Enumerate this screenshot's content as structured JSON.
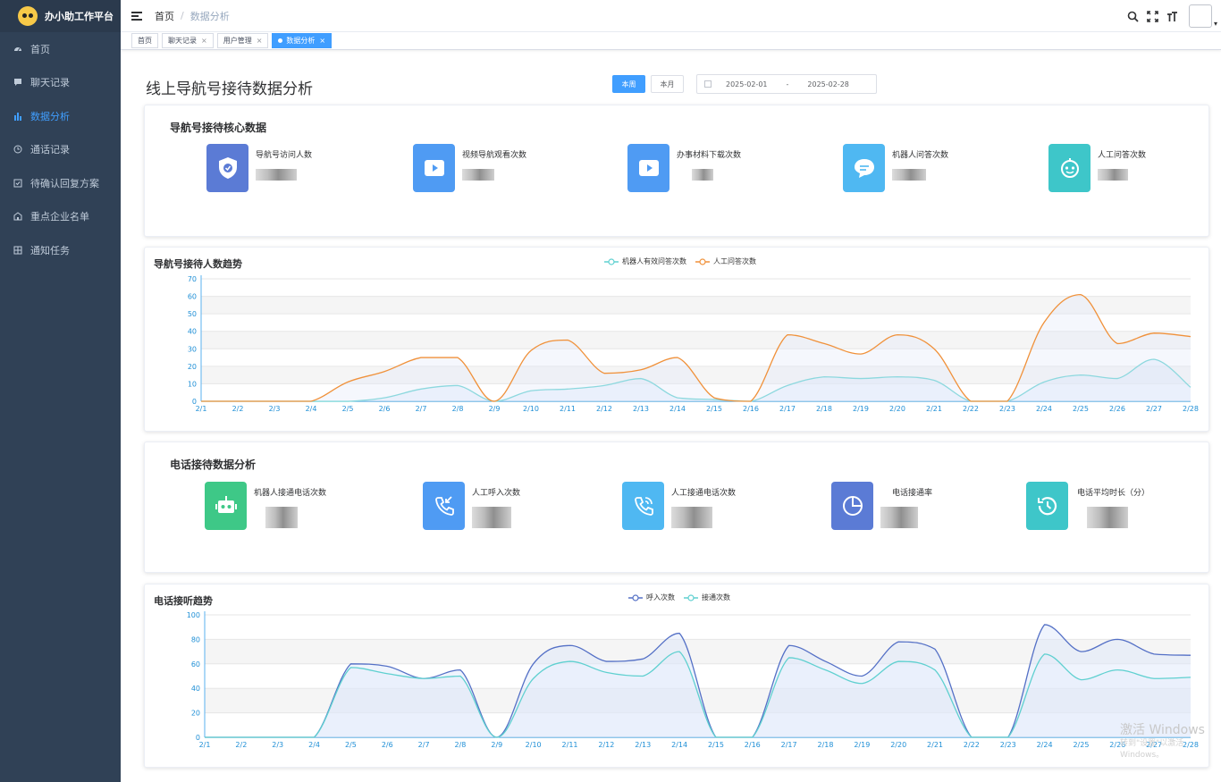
{
  "app": {
    "title": "办小助工作平台"
  },
  "sidebar": {
    "items": [
      {
        "label": "首页",
        "icon": "dashboard-icon",
        "active": false
      },
      {
        "label": "聊天记录",
        "icon": "message-icon",
        "active": false
      },
      {
        "label": "数据分析",
        "icon": "chart-icon",
        "active": true
      },
      {
        "label": "通话记录",
        "icon": "clock-icon",
        "active": false
      },
      {
        "label": "待确认回复方案",
        "icon": "checkbox-icon",
        "active": false
      },
      {
        "label": "重点企业名单",
        "icon": "building-icon",
        "active": false
      },
      {
        "label": "通知任务",
        "icon": "grid-icon",
        "active": false
      }
    ]
  },
  "navbar": {
    "breadcrumb": [
      "首页",
      "数据分析"
    ],
    "separator": "/"
  },
  "tags": [
    {
      "label": "首页",
      "closable": false,
      "active": false
    },
    {
      "label": "聊天记录",
      "closable": true,
      "active": false
    },
    {
      "label": "用户管理",
      "closable": true,
      "active": false
    },
    {
      "label": "数据分析",
      "closable": true,
      "active": true
    }
  ],
  "page": {
    "title": "线上导航号接待数据分析",
    "btn_week": "本周",
    "btn_month": "本月",
    "date_start": "2025-02-01",
    "date_sep": "-",
    "date_end": "2025-02-28"
  },
  "nav_core": {
    "title": "导航号接待核心数据",
    "stats": [
      {
        "label": "导航号访问人数",
        "icon": "shield-check-icon",
        "color": "#5b7bd5"
      },
      {
        "label": "视频导航观看次数",
        "icon": "play-icon",
        "color": "#4f9bf3"
      },
      {
        "label": "办事材料下载次数",
        "icon": "play-icon",
        "color": "#4f9bf3"
      },
      {
        "label": "机器人问答次数",
        "icon": "chat-bubble-icon",
        "color": "#4fb8f2"
      },
      {
        "label": "人工问答次数",
        "icon": "robot-face-icon",
        "color": "#3ec6c9"
      }
    ]
  },
  "phone_core": {
    "title": "电话接待数据分析",
    "stats": [
      {
        "label": "机器人接通电话次数",
        "icon": "robot-icon",
        "color": "#3ec887"
      },
      {
        "label": "人工呼入次数",
        "icon": "incoming-call-icon",
        "color": "#4f9bf3"
      },
      {
        "label": "人工接通电话次数",
        "icon": "phone-icon",
        "color": "#4fb8f2"
      },
      {
        "label": "电话接通率",
        "icon": "pie-icon",
        "color": "#5b7bd5"
      },
      {
        "label": "电话平均时长（分）",
        "icon": "history-icon",
        "color": "#3ec6c9"
      }
    ]
  },
  "watermark": {
    "line1": "激活 Windows",
    "line2": "转到\"设置\"以激活 Windows。"
  },
  "chart_data": [
    {
      "type": "area",
      "title": "导航号接待人数趋势",
      "x": [
        "2/1",
        "2/2",
        "2/3",
        "2/4",
        "2/5",
        "2/6",
        "2/7",
        "2/8",
        "2/9",
        "2/10",
        "2/11",
        "2/12",
        "2/13",
        "2/14",
        "2/15",
        "2/16",
        "2/17",
        "2/18",
        "2/19",
        "2/20",
        "2/21",
        "2/22",
        "2/23",
        "2/24",
        "2/25",
        "2/26",
        "2/27",
        "2/28"
      ],
      "ylim": [
        0,
        70
      ],
      "yticks": [
        0,
        10,
        20,
        30,
        40,
        50,
        60,
        70
      ],
      "grid": true,
      "legend_position": "top-center",
      "series": [
        {
          "name": "机器人有效问答次数",
          "color": "#5fd0d0",
          "values": [
            0,
            0,
            0,
            0,
            0,
            2,
            7,
            9,
            0,
            6,
            7,
            9,
            13,
            2,
            1,
            0,
            9,
            14,
            13,
            14,
            12,
            0,
            0,
            11,
            15,
            13,
            24,
            8
          ]
        },
        {
          "name": "人工问答次数",
          "color": "#f0913a",
          "values": [
            0,
            0,
            0,
            0,
            11,
            17,
            25,
            25,
            0,
            29,
            35,
            16,
            18,
            25,
            2,
            0,
            38,
            33,
            27,
            38,
            30,
            0,
            0,
            45,
            61,
            33,
            39,
            37
          ]
        }
      ]
    },
    {
      "type": "area",
      "title": "电话接听趋势",
      "x": [
        "2/1",
        "2/2",
        "2/3",
        "2/4",
        "2/5",
        "2/6",
        "2/7",
        "2/8",
        "2/9",
        "2/10",
        "2/11",
        "2/12",
        "2/13",
        "2/14",
        "2/15",
        "2/16",
        "2/17",
        "2/18",
        "2/19",
        "2/20",
        "2/21",
        "2/22",
        "2/23",
        "2/24",
        "2/25",
        "2/26",
        "2/27",
        "2/28"
      ],
      "ylim": [
        0,
        100
      ],
      "yticks": [
        0,
        20,
        40,
        60,
        80,
        100
      ],
      "grid": true,
      "legend_position": "top-center",
      "series": [
        {
          "name": "呼入次数",
          "color": "#5470c6",
          "values": [
            0,
            0,
            0,
            0,
            60,
            58,
            48,
            55,
            0,
            60,
            75,
            62,
            64,
            85,
            0,
            0,
            75,
            62,
            50,
            78,
            72,
            0,
            0,
            92,
            70,
            80,
            68,
            67
          ]
        },
        {
          "name": "接通次数",
          "color": "#5fd0d0",
          "values": [
            0,
            0,
            0,
            0,
            57,
            52,
            48,
            50,
            0,
            48,
            62,
            53,
            50,
            70,
            0,
            0,
            65,
            55,
            44,
            62,
            55,
            0,
            0,
            68,
            47,
            55,
            48,
            49
          ]
        }
      ]
    }
  ]
}
